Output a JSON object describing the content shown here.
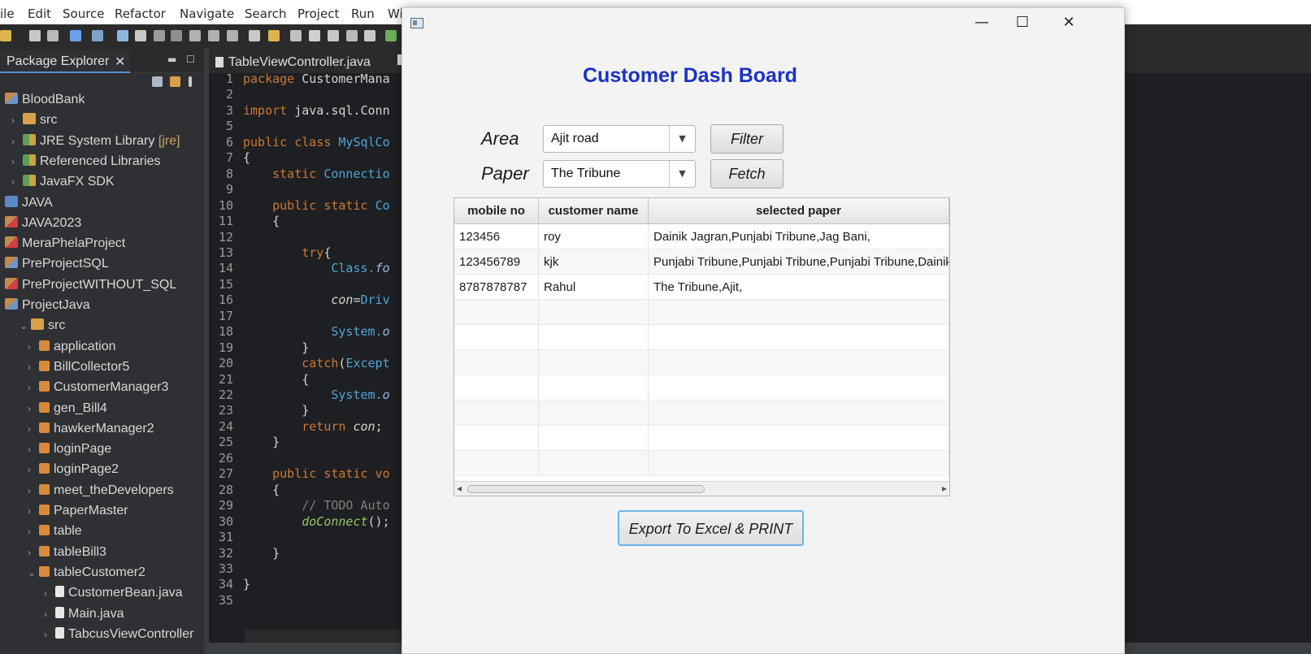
{
  "menu": [
    "ile",
    "Edit",
    "Source",
    "Refactor",
    "Navigate",
    "Search",
    "Project",
    "Run",
    "Win"
  ],
  "explorer": {
    "tab_label": "Package Explorer",
    "close_glyph": "✕",
    "items": [
      {
        "label": "BloodBank",
        "icon": "project"
      },
      {
        "label": "src",
        "icon": "source-folder"
      },
      {
        "label": "JRE System Library",
        "suffix": "[jre]",
        "icon": "library"
      },
      {
        "label": "Referenced Libraries",
        "icon": "library"
      },
      {
        "label": "JavaFX SDK",
        "icon": "library"
      },
      {
        "label": "JAVA",
        "icon": "folder"
      },
      {
        "label": "JAVA2023",
        "icon": "project-error"
      },
      {
        "label": "MeraPhelaProject",
        "icon": "project-error"
      },
      {
        "label": "PreProjectSQL",
        "icon": "project"
      },
      {
        "label": "PreProjectWITHOUT_SQL",
        "icon": "project-error"
      },
      {
        "label": "ProjectJava",
        "icon": "project"
      },
      {
        "label": "src",
        "icon": "source-folder"
      },
      {
        "label": "application",
        "icon": "package"
      },
      {
        "label": "BillCollector5",
        "icon": "package"
      },
      {
        "label": "CustomerManager3",
        "icon": "package"
      },
      {
        "label": "gen_Bill4",
        "icon": "package"
      },
      {
        "label": "hawkerManager2",
        "icon": "package"
      },
      {
        "label": "loginPage",
        "icon": "package"
      },
      {
        "label": "loginPage2",
        "icon": "package"
      },
      {
        "label": "meet_theDevelopers",
        "icon": "package"
      },
      {
        "label": "PaperMaster",
        "icon": "package"
      },
      {
        "label": "table",
        "icon": "package"
      },
      {
        "label": "tableBill3",
        "icon": "package"
      },
      {
        "label": "tableCustomer2",
        "icon": "package"
      },
      {
        "label": "CustomerBean.java",
        "icon": "java-file"
      },
      {
        "label": "Main.java",
        "icon": "java-file"
      },
      {
        "label": "TabcusViewController",
        "icon": "java-file"
      }
    ]
  },
  "editor": {
    "tab_label": "TableViewController.java",
    "lines": [
      {
        "n": "1",
        "parts": [
          [
            "k",
            "package "
          ],
          [
            "",
            "CustomerMana"
          ]
        ]
      },
      {
        "n": "2",
        "parts": []
      },
      {
        "n": "3",
        "parts": [
          [
            "k",
            "import "
          ],
          [
            "",
            "java.sql.Conn"
          ]
        ]
      },
      {
        "n": "5",
        "parts": []
      },
      {
        "n": "6",
        "parts": [
          [
            "k",
            "public class "
          ],
          [
            "t",
            "MySqlCo"
          ]
        ]
      },
      {
        "n": "7",
        "parts": [
          [
            "",
            "{"
          ]
        ]
      },
      {
        "n": "8",
        "parts": [
          [
            "",
            "    "
          ],
          [
            "k",
            "static "
          ],
          [
            "t",
            "Connectio"
          ]
        ]
      },
      {
        "n": "9",
        "parts": []
      },
      {
        "n": "10",
        "parts": [
          [
            "",
            "    "
          ],
          [
            "k",
            "public static "
          ],
          [
            "t",
            "Co"
          ]
        ]
      },
      {
        "n": "11",
        "parts": [
          [
            "",
            "    {"
          ]
        ]
      },
      {
        "n": "12",
        "parts": []
      },
      {
        "n": "13",
        "parts": [
          [
            "",
            "        "
          ],
          [
            "k",
            "try"
          ],
          [
            "",
            "{"
          ]
        ]
      },
      {
        "n": "14",
        "parts": [
          [
            "",
            "            "
          ],
          [
            "t",
            "Class."
          ],
          [
            "it",
            "fo"
          ]
        ]
      },
      {
        "n": "15",
        "parts": []
      },
      {
        "n": "16",
        "parts": [
          [
            "",
            "            "
          ],
          [
            "v",
            "con"
          ],
          [
            "",
            "="
          ],
          [
            "t",
            "Driv"
          ]
        ]
      },
      {
        "n": "17",
        "parts": []
      },
      {
        "n": "18",
        "parts": [
          [
            "",
            "            "
          ],
          [
            "t",
            "System."
          ],
          [
            "it",
            "o"
          ]
        ]
      },
      {
        "n": "19",
        "parts": [
          [
            "",
            "        }"
          ]
        ]
      },
      {
        "n": "20",
        "parts": [
          [
            "",
            "        "
          ],
          [
            "k",
            "catch"
          ],
          [
            "",
            "("
          ],
          [
            "t",
            "Except"
          ]
        ]
      },
      {
        "n": "21",
        "parts": [
          [
            "",
            "        {"
          ]
        ]
      },
      {
        "n": "22",
        "parts": [
          [
            "",
            "            "
          ],
          [
            "t",
            "System."
          ],
          [
            "it",
            "o"
          ]
        ]
      },
      {
        "n": "23",
        "parts": [
          [
            "",
            "        }"
          ]
        ]
      },
      {
        "n": "24",
        "parts": [
          [
            "",
            "        "
          ],
          [
            "k",
            "return "
          ],
          [
            "v",
            "con"
          ],
          [
            "",
            ";"
          ]
        ]
      },
      {
        "n": "25",
        "parts": [
          [
            "",
            "    }"
          ]
        ]
      },
      {
        "n": "26",
        "parts": []
      },
      {
        "n": "27",
        "parts": [
          [
            "",
            "    "
          ],
          [
            "k",
            "public static vo"
          ]
        ]
      },
      {
        "n": "28",
        "parts": [
          [
            "",
            "    {"
          ]
        ]
      },
      {
        "n": "29",
        "parts": [
          [
            "",
            "        "
          ],
          [
            "cm",
            "// TODO Auto"
          ]
        ]
      },
      {
        "n": "30",
        "parts": [
          [
            "",
            "        "
          ],
          [
            "fn",
            "doConnect"
          ],
          [
            "",
            "();"
          ]
        ]
      },
      {
        "n": "31",
        "parts": []
      },
      {
        "n": "32",
        "parts": [
          [
            "",
            "    }"
          ]
        ]
      },
      {
        "n": "33",
        "parts": []
      },
      {
        "n": "34",
        "parts": [
          [
            "",
            "}"
          ]
        ]
      },
      {
        "n": "35",
        "parts": []
      }
    ]
  },
  "dialog": {
    "min_glyph": "—",
    "max_glyph": "☐",
    "close_glyph": "✕",
    "title": "Customer Dash Board",
    "area_label": "Area",
    "area_value": "Ajit road",
    "paper_label": "Paper",
    "paper_value": "The Tribune",
    "combo_arrow": "▼",
    "filter_label": "Filter",
    "fetch_label": "Fetch",
    "export_label": "Export To Excel & PRINT",
    "table": {
      "headers": [
        "mobile no",
        "customer name",
        "selected paper"
      ],
      "rows": [
        [
          "123456",
          "roy",
          "Dainik Jagran,Punjabi Tribune,Jag Bani,"
        ],
        [
          "123456789",
          "kjk",
          "Punjabi Tribune,Punjabi Tribune,Punjabi Tribune,Dainik"
        ],
        [
          "8787878787",
          "Rahul",
          "The Tribune,Ajit,"
        ],
        [
          "",
          "",
          ""
        ],
        [
          "",
          "",
          ""
        ],
        [
          "",
          "",
          ""
        ],
        [
          "",
          "",
          ""
        ],
        [
          "",
          "",
          ""
        ],
        [
          "",
          "",
          ""
        ],
        [
          "",
          "",
          ""
        ]
      ]
    }
  }
}
